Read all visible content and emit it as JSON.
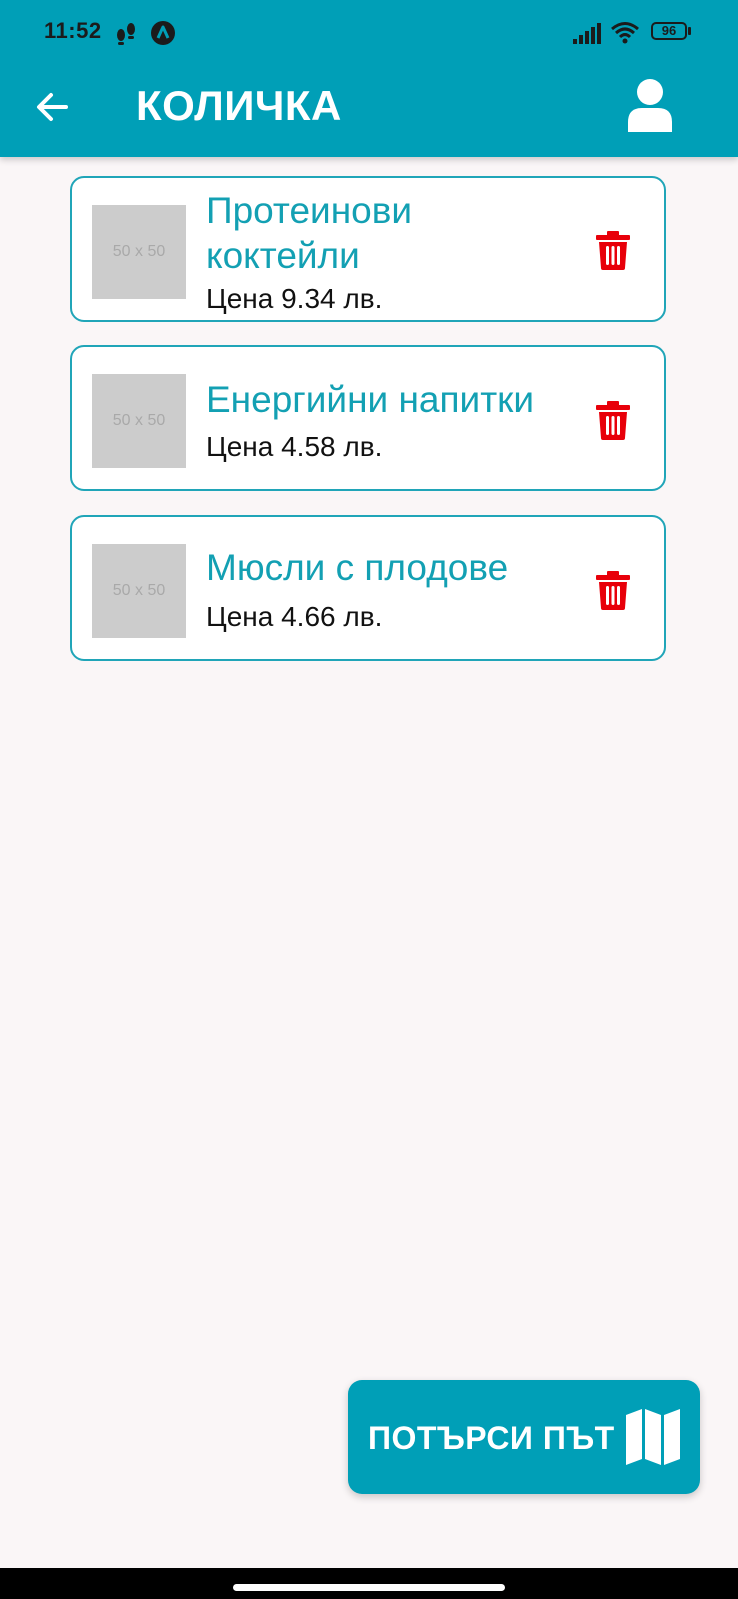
{
  "status_bar": {
    "time": "11:52",
    "battery": "96"
  },
  "app_bar": {
    "title": "КОЛИЧКА",
    "back_icon": "arrow-left-icon",
    "profile_icon": "user-icon"
  },
  "cart": {
    "items": [
      {
        "name_line1": "Протеинови",
        "name_line2": "коктейли",
        "price": "Цена 9.34 лв.",
        "thumbnail": "50 x 50"
      },
      {
        "name_line1": "Енергийни напитки",
        "name_line2": "",
        "price": "Цена 4.58 лв.",
        "thumbnail": "50 x 50"
      },
      {
        "name_line1": "Мюсли с плодове",
        "name_line2": "",
        "price": "Цена 4.66 лв.",
        "thumbnail": "50 x 50"
      }
    ]
  },
  "fab": {
    "label": "ПОТЪРСИ ПЪТ",
    "icon": "map-icon"
  },
  "colors": {
    "primary": "#009fb7",
    "accent_text": "#13a0b3",
    "delete": "#e8000a",
    "background": "#faf6f7"
  }
}
